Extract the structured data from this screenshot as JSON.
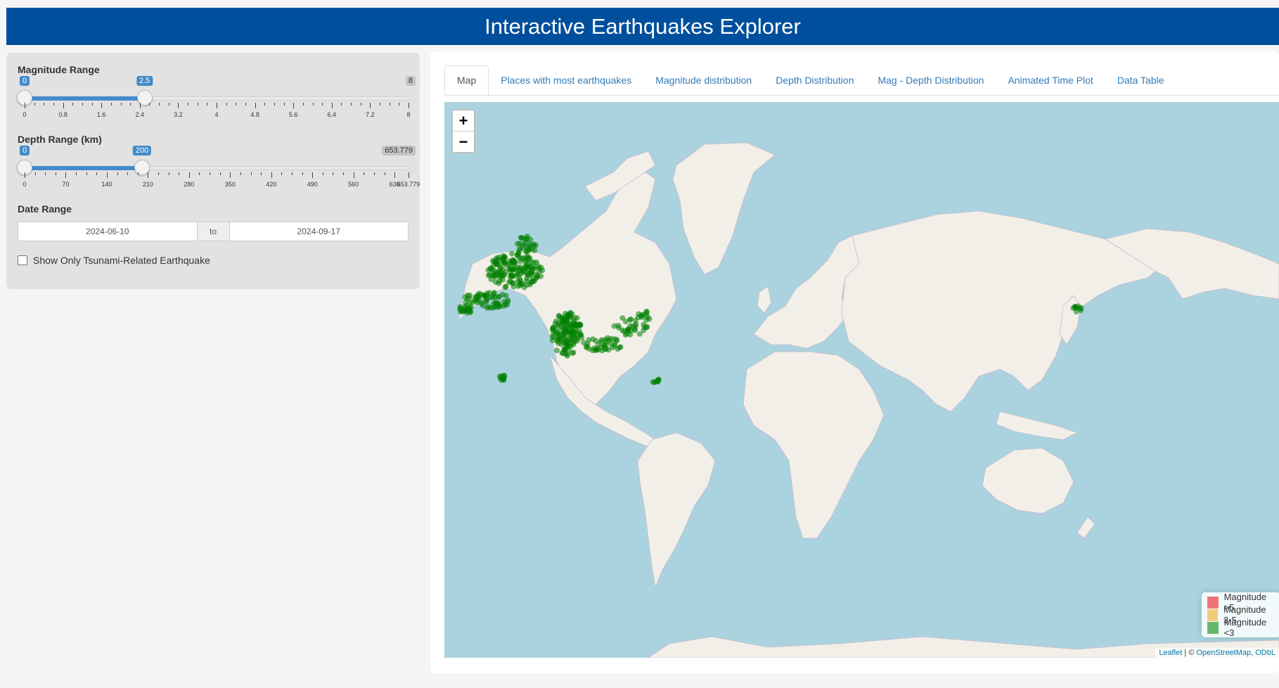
{
  "header": {
    "title": "Interactive Earthquakes Explorer"
  },
  "sidebar": {
    "magnitude": {
      "label": "Magnitude Range",
      "min": 0,
      "max": 8,
      "from_label": "0",
      "to_label": "2.5",
      "max_label": "8",
      "from_value": 0,
      "to_value": 2.5,
      "ticks": [
        "0",
        "0.8",
        "1.6",
        "2.4",
        "3.2",
        "4",
        "4.8",
        "5.6",
        "6.4",
        "7.2",
        "8"
      ]
    },
    "depth": {
      "label": "Depth Range (km)",
      "min": 0,
      "max": 653.779,
      "from_label": "0",
      "to_label": "200",
      "max_label": "653.779",
      "from_value": 0,
      "to_value": 200,
      "ticks": [
        "0",
        "70",
        "140",
        "210",
        "280",
        "350",
        "420",
        "490",
        "560",
        "630",
        "653.779"
      ]
    },
    "date_range": {
      "label": "Date Range",
      "start": "2024-06-10",
      "separator": "to",
      "end": "2024-09-17"
    },
    "tsunami_checkbox": {
      "label": "Show Only Tsunami-Related Earthquake",
      "checked": false
    }
  },
  "tabs": [
    "Map",
    "Places with most earthquakes",
    "Magnitude distribution",
    "Depth Distribution",
    "Mag - Depth Distribution",
    "Animated Time Plot",
    "Data Table"
  ],
  "active_tab": "Map",
  "map": {
    "zoom_in": "+",
    "zoom_out": "−",
    "ocean_color": "#aad3df",
    "land_color": "#f2efe9",
    "marker_color": "#008000",
    "legend": [
      {
        "label": "Magnitude >5",
        "color": "#f03b3b"
      },
      {
        "label": "Magnitude 3-5",
        "color": "#f5b942"
      },
      {
        "label": "Magnitude <3",
        "color": "#2e9a2e"
      }
    ],
    "attribution": {
      "leaflet": "Leaflet",
      "sep": " | © ",
      "osm": "OpenStreetMap, ODbL"
    }
  }
}
